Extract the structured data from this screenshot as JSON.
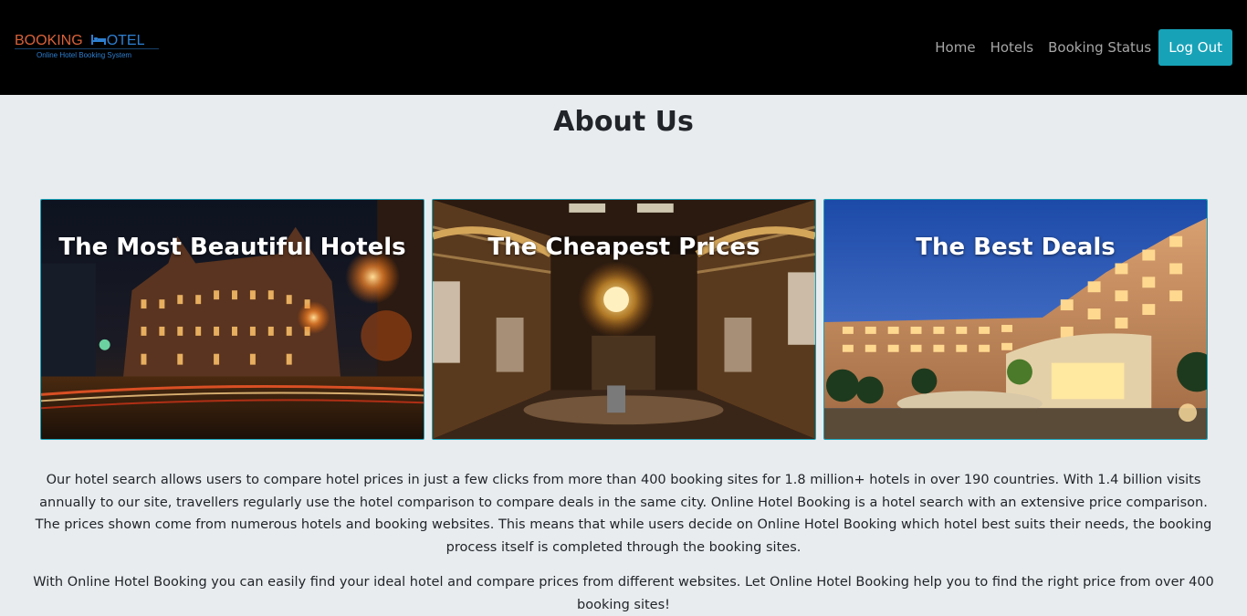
{
  "brand": {
    "word1": "BOOKING",
    "word2": "OTEL",
    "tagline": "Online Hotel Booking System",
    "colors": {
      "orange": "#d9623a",
      "blue": "#2d7fd1"
    }
  },
  "nav": {
    "items": [
      {
        "label": "Home"
      },
      {
        "label": "Hotels"
      },
      {
        "label": "Booking Status"
      }
    ],
    "logout_label": "Log Out",
    "accent": "#17a2b8"
  },
  "page": {
    "title": "About Us"
  },
  "cards": [
    {
      "title": "The Most Beautiful Hotels",
      "image": "night-city-hotel-street"
    },
    {
      "title": "The Cheapest Prices",
      "image": "ornate-hotel-lobby-chandelier"
    },
    {
      "title": "The Best Deals",
      "image": "resort-hotel-at-dusk"
    }
  ],
  "about": {
    "paragraph1": "Our hotel search allows users to compare hotel prices in just a few clicks from more than 400 booking sites for 1.8 million+ hotels in over 190 countries. With 1.4 billion visits annually to our site, travellers regularly use the hotel comparison to compare deals in the same city. Online Hotel Booking is a hotel search with an extensive price comparison. The prices shown come from numerous hotels and booking websites. This means that while users decide on Online Hotel Booking which hotel best suits their needs, the booking process itself is completed through the booking sites.",
    "paragraph2": "With Online Hotel Booking you can easily find your ideal hotel and compare prices from different websites. Let Online Hotel Booking help you to find the right price from over 400 booking sites!"
  }
}
